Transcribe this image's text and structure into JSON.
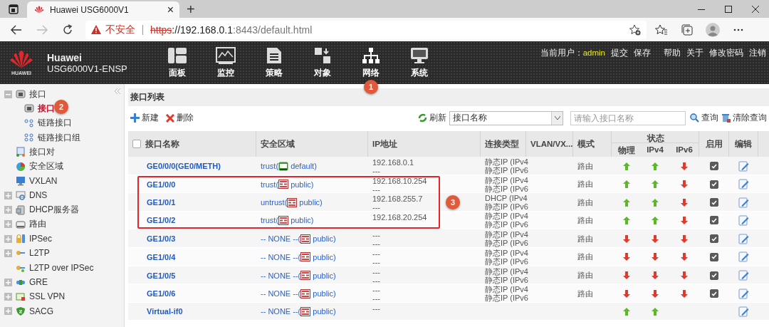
{
  "browser": {
    "tab_title": "Huawei USG6000V1",
    "tab_close": "×",
    "new_tab": "+",
    "security": "不安全",
    "url_scheme": "https",
    "url_host": "://192.168.0.1",
    "url_rest": ":8443/default.html"
  },
  "header": {
    "brand": "Huawei",
    "logo_text": "HUAWEI",
    "model": "USG6000V1-ENSP",
    "user_label": "当前用户：",
    "user": "admin",
    "links": [
      "提交",
      "保存",
      "帮助",
      "关于",
      "修改密码",
      "注销"
    ],
    "nav": [
      {
        "label": "面板"
      },
      {
        "label": "监控"
      },
      {
        "label": "策略"
      },
      {
        "label": "对象"
      },
      {
        "label": "网络",
        "badge": "1"
      },
      {
        "label": "系统"
      }
    ]
  },
  "sidebar": {
    "items": [
      {
        "label": "接口",
        "expanded": true,
        "children": [
          {
            "label": "接口",
            "selected": true,
            "badge": "2"
          },
          {
            "label": "链路接口",
            "selected": false
          },
          {
            "label": "链路接口组",
            "selected": false
          }
        ]
      },
      {
        "label": "接口对"
      },
      {
        "label": "安全区域"
      },
      {
        "label": "VXLAN"
      },
      {
        "label": "DNS",
        "expanded": false
      },
      {
        "label": "DHCP服务器",
        "expanded": false
      },
      {
        "label": "路由",
        "expanded": false
      },
      {
        "label": "IPSec",
        "expanded": false
      },
      {
        "label": "L2TP",
        "expanded": false
      },
      {
        "label": "L2TP over IPSec"
      },
      {
        "label": "GRE",
        "expanded": false
      },
      {
        "label": "SSL VPN",
        "expanded": false
      },
      {
        "label": "SACG",
        "expanded": false
      }
    ]
  },
  "panel": {
    "title": "接口列表",
    "toolbar": {
      "new": "新建",
      "delete": "删除",
      "refresh": "刷新",
      "filter_select": "接口名称",
      "search_placeholder": "请输入接口名称",
      "query": "查询",
      "clear_query": "清除查询"
    },
    "table": {
      "select_all": false,
      "columns": [
        "接口名称",
        "安全区域",
        "IP地址",
        "连接类型",
        "VLAN/VX...",
        "模式",
        "状态",
        "启用",
        "编辑"
      ],
      "status_columns": [
        "物理",
        "IPv4",
        "IPv6"
      ],
      "rows": [
        {
          "name": "GE0/0/0(GE0/METH)",
          "zone": "trust(",
          "vsys": "default)",
          "root_vsys": true,
          "ip": [
            "192.168.0.1",
            "---"
          ],
          "conn": [
            "静态IP (IPv4",
            "静态IP (IPv6"
          ],
          "mode": "路由",
          "phys_up": true,
          "ipv4_up": true,
          "ipv6_up": false,
          "enabled": true,
          "boxed": false
        },
        {
          "name": "GE1/0/0",
          "zone": "trust(",
          "vsys": "public)",
          "root_vsys": false,
          "ip": [
            "192.168.10.254",
            "---"
          ],
          "conn": [
            "静态IP (IPv4",
            "静态IP (IPv6"
          ],
          "mode": "路由",
          "phys_up": true,
          "ipv4_up": true,
          "ipv6_up": false,
          "enabled": true,
          "boxed": true
        },
        {
          "name": "GE1/0/1",
          "zone": "untrust(",
          "vsys": "public)",
          "root_vsys": false,
          "ip": [
            "192.168.255.7",
            "---"
          ],
          "conn": [
            "DHCP (IPv4",
            "静态IP (IPv6"
          ],
          "mode": "路由",
          "phys_up": true,
          "ipv4_up": true,
          "ipv6_up": false,
          "enabled": true,
          "boxed": true
        },
        {
          "name": "GE1/0/2",
          "zone": "trust(",
          "vsys": "public)",
          "root_vsys": false,
          "ip": [
            "192.168.20.254"
          ],
          "conn": [
            "静态IP (IPv4",
            "静态IP (IPv6"
          ],
          "mode": "路由",
          "phys_up": true,
          "ipv4_up": true,
          "ipv6_up": false,
          "enabled": true,
          "boxed": true
        },
        {
          "name": "GE1/0/3",
          "zone": "-- NONE --(",
          "vsys": "public)",
          "root_vsys": false,
          "ip": [
            "---",
            "---"
          ],
          "conn": [
            "静态IP (IPv4",
            "静态IP (IPv6"
          ],
          "mode": "路由",
          "phys_up": false,
          "ipv4_up": false,
          "ipv6_up": false,
          "enabled": true,
          "boxed": false
        },
        {
          "name": "GE1/0/4",
          "zone": "-- NONE --(",
          "vsys": "public)",
          "root_vsys": false,
          "ip": [
            "---",
            "---"
          ],
          "conn": [
            "静态IP (IPv4",
            "静态IP (IPv6"
          ],
          "mode": "路由",
          "phys_up": false,
          "ipv4_up": false,
          "ipv6_up": false,
          "enabled": true,
          "boxed": false
        },
        {
          "name": "GE1/0/5",
          "zone": "-- NONE --(",
          "vsys": "public)",
          "root_vsys": false,
          "ip": [
            "---",
            "---"
          ],
          "conn": [
            "静态IP (IPv4",
            "静态IP (IPv6"
          ],
          "mode": "路由",
          "phys_up": false,
          "ipv4_up": false,
          "ipv6_up": false,
          "enabled": true,
          "boxed": false
        },
        {
          "name": "GE1/0/6",
          "zone": "-- NONE --(",
          "vsys": "public)",
          "root_vsys": false,
          "ip": [
            "---",
            "---"
          ],
          "conn": [
            "静态IP (IPv4",
            "静态IP (IPv6"
          ],
          "mode": "路由",
          "phys_up": false,
          "ipv4_up": false,
          "ipv6_up": false,
          "enabled": true,
          "boxed": false
        },
        {
          "name": "Virtual-if0",
          "zone": "-- NONE --(",
          "vsys": "public)",
          "root_vsys": false,
          "ip": [
            "---"
          ],
          "phys_up": true,
          "ipv4_up": true,
          "boxed": false
        }
      ],
      "callout_badge": "3"
    }
  }
}
